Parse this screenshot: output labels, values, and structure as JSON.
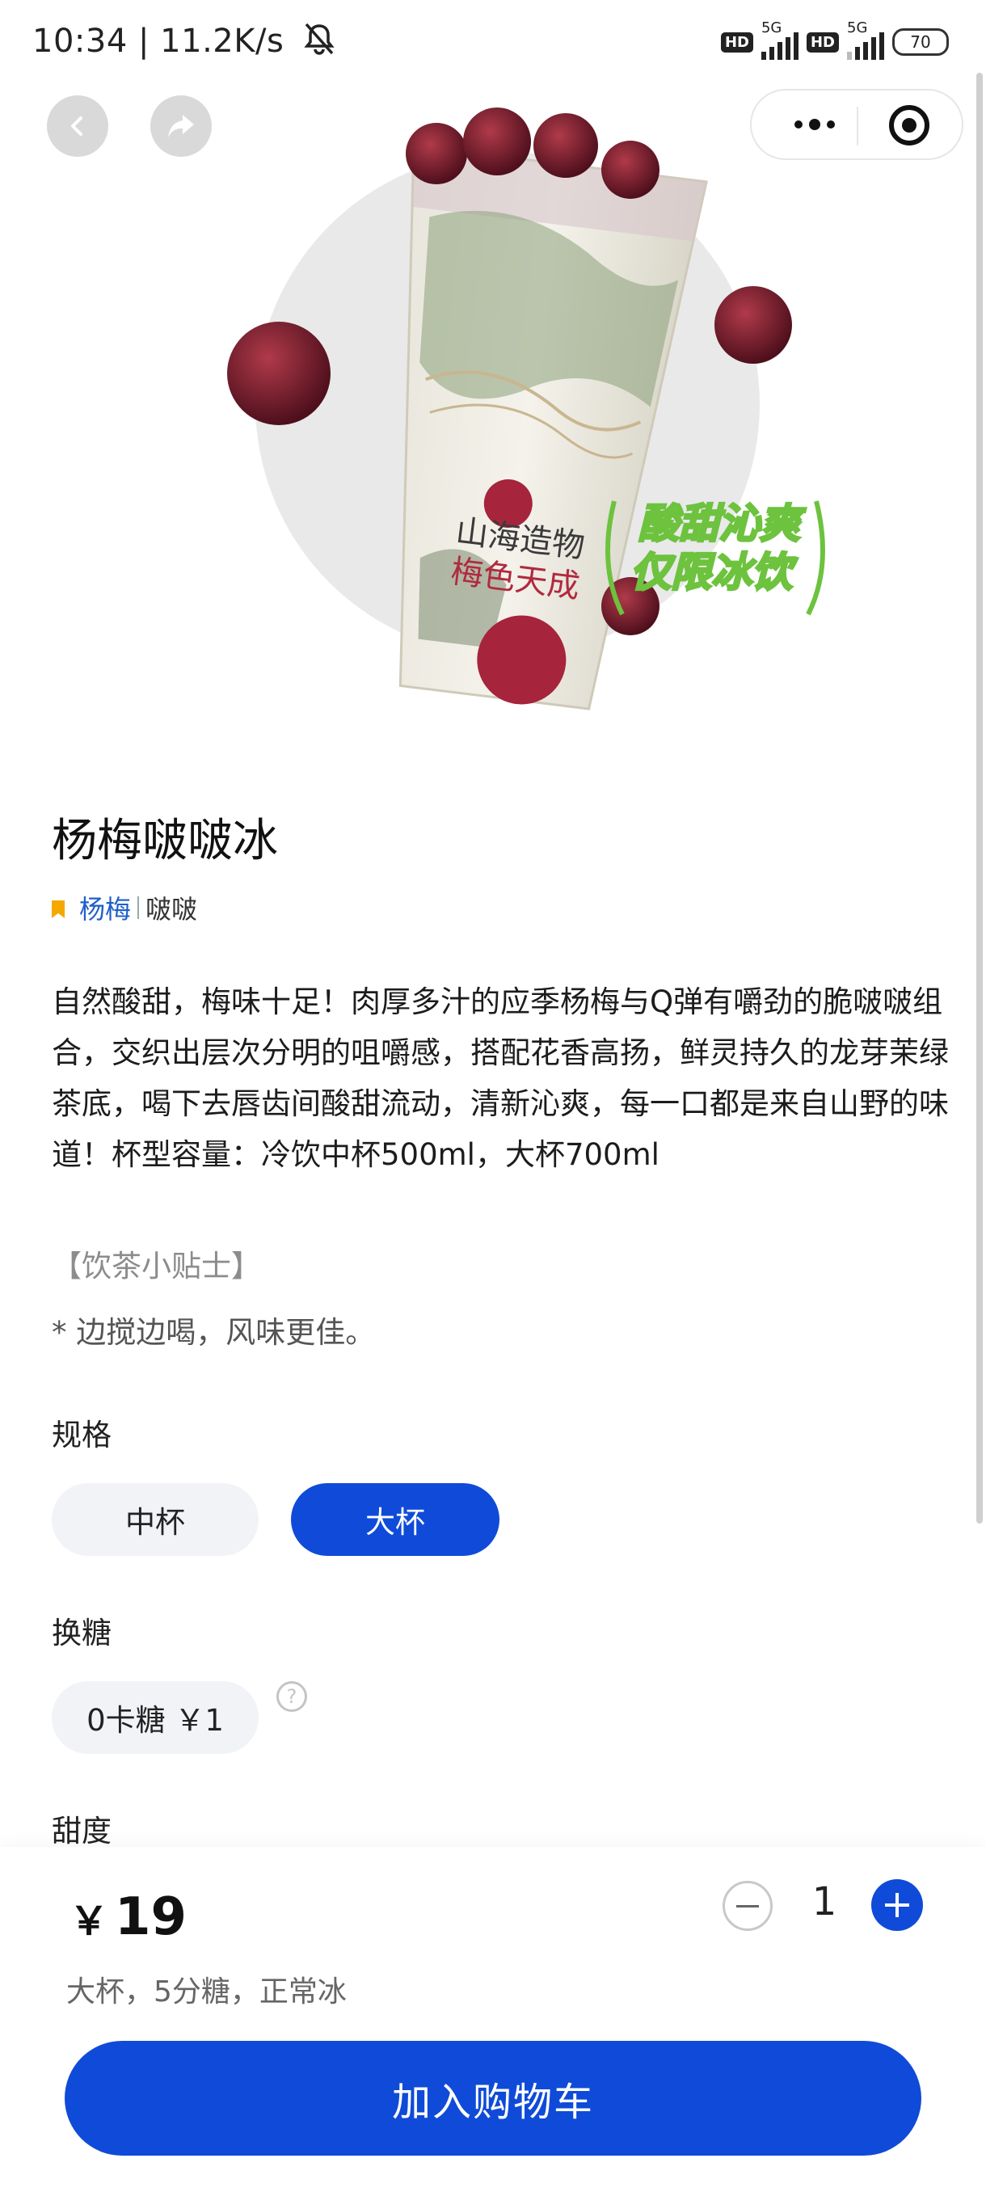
{
  "status_bar": {
    "time_speed": "10:34 | 11.2K/s",
    "net_label_1": "HD",
    "net_5g_1": "5G",
    "net_label_2": "HD",
    "net_5g_2": "5G",
    "battery": "70"
  },
  "hero": {
    "slogan_line1": "酸甜沁爽",
    "slogan_line2": "仅限冰饮",
    "cup_text_line1": "山海造物",
    "cup_text_line2": "梅色天成"
  },
  "product": {
    "title": "杨梅啵啵冰",
    "tag_primary": "杨梅",
    "tag_secondary": "啵啵",
    "description": "自然酸甜，梅味十足！肉厚多汁的应季杨梅与Q弹有嚼劲的脆啵啵组合，交织出层次分明的咀嚼感，搭配花香高扬，鲜灵持久的龙芽茉绿茶底，喝下去唇齿间酸甜流动，清新沁爽，每一口都是来自山野的味道！杯型容量：冷饮中杯500ml，大杯700ml",
    "tip_title": "【饮茶小贴士】",
    "tip_text": "* 边搅边喝，风味更佳。"
  },
  "options": {
    "size_label": "规格",
    "size_options": [
      "中杯",
      "大杯"
    ],
    "size_selected": "大杯",
    "sugar_label": "换糖",
    "sugar_option": "0卡糖 ￥1",
    "sweetness_label": "甜度"
  },
  "footer": {
    "currency": "￥",
    "price": "19",
    "summary": "大杯，5分糖，正常冰",
    "quantity": "1",
    "add_to_cart": "加入购物车"
  },
  "colors": {
    "accent": "#0f4bd8",
    "tag_icon": "#f5a800",
    "slogan_green": "#6dc23e"
  },
  "icons": [
    "back-icon",
    "share-icon",
    "more-icon",
    "close-miniapp-icon",
    "help-icon",
    "minus-icon",
    "plus-icon",
    "bookmark-icon"
  ]
}
